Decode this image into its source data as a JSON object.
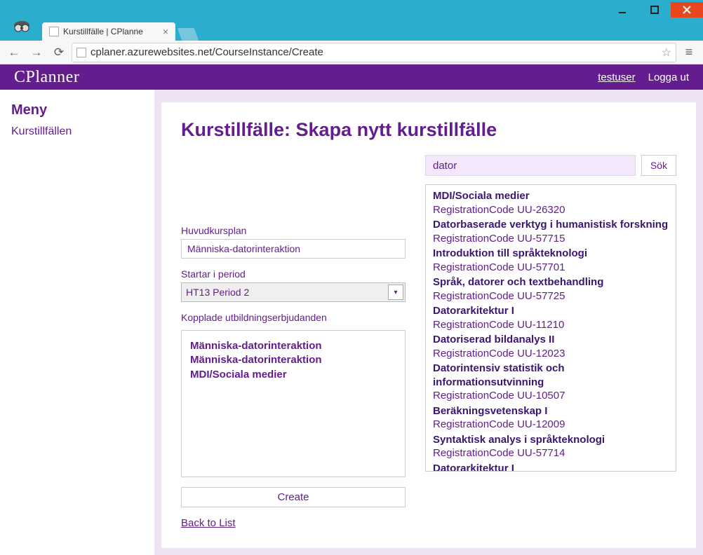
{
  "window": {
    "tab_title": "Kurstillfälle | CPlanne",
    "url": "cplaner.azurewebsites.net/CourseInstance/Create"
  },
  "header": {
    "brand": "CPlanner",
    "user": "testuser",
    "logout": "Logga ut"
  },
  "sidebar": {
    "heading": "Meny",
    "item": "Kurstillfällen"
  },
  "page": {
    "title_strong": "Kurstillfälle:",
    "title_rest": " Skapa nytt kurstillfälle",
    "labels": {
      "main_plan": "Huvudkursplan",
      "period": "Startar i period",
      "linked": "Kopplade utbildningserbjudanden"
    },
    "main_plan_value": "Människa-datorinteraktion",
    "period_value": "HT13 Period 2",
    "linked_items": [
      "Människa-datorinteraktion",
      "Människa-datorinteraktion",
      "MDI/Sociala medier"
    ],
    "create_label": "Create",
    "back_label": "Back to List"
  },
  "search": {
    "query": "dator",
    "button": "Sök",
    "results": [
      {
        "name": "MDI/Sociala medier",
        "code": "RegistrationCode UU-26320"
      },
      {
        "name": "Datorbaserade verktyg i humanistisk forskning",
        "code": "RegistrationCode UU-57715"
      },
      {
        "name": "Introduktion till språkteknologi",
        "code": "RegistrationCode UU-57701"
      },
      {
        "name": "Språk, datorer och textbehandling",
        "code": "RegistrationCode UU-57725"
      },
      {
        "name": "Datorarkitektur I",
        "code": "RegistrationCode UU-11210"
      },
      {
        "name": "Datoriserad bildanalys II",
        "code": "RegistrationCode UU-12023"
      },
      {
        "name": "Datorintensiv statistik och informationsutvinning",
        "code": "RegistrationCode UU-10507"
      },
      {
        "name": "Beräkningsvetenskap I",
        "code": "RegistrationCode UU-12009"
      },
      {
        "name": "Syntaktisk analys i språkteknologi",
        "code": "RegistrationCode UU-57714"
      },
      {
        "name": "Datorarkitektur I",
        "code": ""
      }
    ]
  }
}
